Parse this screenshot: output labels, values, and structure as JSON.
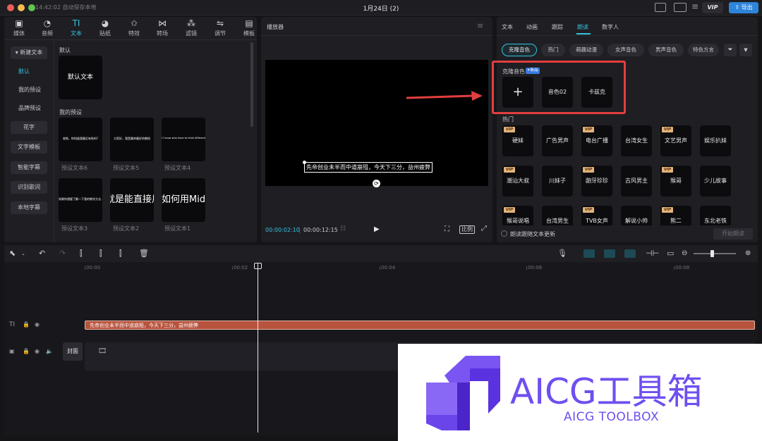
{
  "titlebar": {
    "autosave": "14:42:02 自动保存本地",
    "title": "1月24日 (2)",
    "vip": "VIP",
    "export": "导出"
  },
  "left_toolbar": [
    {
      "label": "媒体",
      "icon": "media-icon"
    },
    {
      "label": "音频",
      "icon": "audio-icon"
    },
    {
      "label": "文本",
      "icon": "text-icon",
      "active": true
    },
    {
      "label": "贴纸",
      "icon": "sticker-icon"
    },
    {
      "label": "特效",
      "icon": "effects-icon"
    },
    {
      "label": "转场",
      "icon": "transition-icon"
    },
    {
      "label": "滤镜",
      "icon": "filter-icon"
    },
    {
      "label": "调节",
      "icon": "adjust-icon"
    },
    {
      "label": "模板",
      "icon": "template-icon"
    }
  ],
  "left_nav": {
    "new_text": "▾ 新建文本",
    "items": [
      "默认",
      "我的预设",
      "品牌预设"
    ],
    "boxes": [
      "花字",
      "文字模板",
      "智能字幕",
      "识别歌词",
      "本地字幕"
    ]
  },
  "presets": {
    "default_section": "默认",
    "default_text": "默认文本",
    "my_presets_section": "我的预设",
    "cards": [
      {
        "preview": "老铁，你知道我最近有啥吗?",
        "caption": "预设文本6"
      },
      {
        "preview": "大家好，我是最帅最好的教授",
        "caption": "预设文本5"
      },
      {
        "preview": "I l know who have to think differently.",
        "caption": "预设文本4"
      },
      {
        "preview": "如果你想要了解一下我的教学方法 ...",
        "caption": "预设文本3"
      },
      {
        "preview": "就是能直接用",
        "caption": "预设文本2"
      },
      {
        "preview": "如何用Mid",
        "caption": "预设文本1"
      }
    ]
  },
  "player": {
    "title": "播放器",
    "subtitle": "先帝创业未半而中道崩殂，今天下三分，益州疲弊",
    "current_time": "00:00:02:10",
    "total_time": "00:00:12:15",
    "ratio_button": "比例"
  },
  "right_panel": {
    "tabs": [
      "文本",
      "动画",
      "跟踪",
      "朗读",
      "数字人"
    ],
    "active_tab": "朗读",
    "chips": [
      "克隆音色",
      "热门",
      "萌趣动漫",
      "女声音色",
      "男声音色",
      "特色方言"
    ],
    "clone_section": "克隆音色",
    "new_badge": "✦新品",
    "clone_voices": [
      "+",
      "音色02",
      "卡兹克"
    ],
    "hot_section": "热门",
    "hot_voices": [
      {
        "name": "硬妹",
        "vip": true
      },
      {
        "name": "广告男声",
        "vip": false
      },
      {
        "name": "电台广播",
        "vip": true
      },
      {
        "name": "台湾女生",
        "vip": false
      },
      {
        "name": "文艺男声",
        "vip": true
      },
      {
        "name": "娱乐扒妹",
        "vip": false
      },
      {
        "name": "潮汕大叔",
        "vip": true
      },
      {
        "name": "川妹子",
        "vip": false
      },
      {
        "name": "龅牙珍珍",
        "vip": true
      },
      {
        "name": "古风男主",
        "vip": false
      },
      {
        "name": "猴哥",
        "vip": true
      },
      {
        "name": "少儿故事",
        "vip": false
      },
      {
        "name": "猴哥说唱",
        "vip": true
      },
      {
        "name": "台湾男生",
        "vip": false
      },
      {
        "name": "TVB女声",
        "vip": true
      },
      {
        "name": "解说小帅",
        "vip": false
      },
      {
        "name": "熊二",
        "vip": true
      },
      {
        "name": "东北老铁",
        "vip": false
      }
    ],
    "follow_text": "朗读跟随文本更新",
    "start_button": "开始朗读",
    "vip_label": "VIP"
  },
  "timeline": {
    "ruler": [
      "00:00",
      "00:02",
      "00:04",
      "00:06",
      "00:08"
    ],
    "text_clip": "先帝创业未半而中道崩殂，今天下三分，益州疲弊",
    "cover": "封面"
  },
  "watermark": {
    "title": "AICG工具箱",
    "subtitle": "AICG TOOLBOX",
    "color": "#6f4ff0"
  }
}
